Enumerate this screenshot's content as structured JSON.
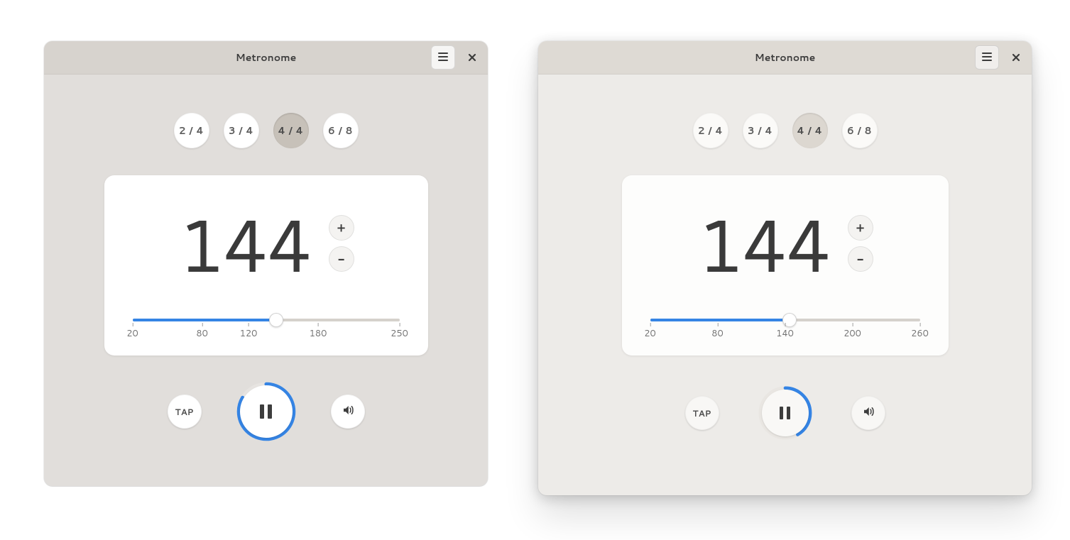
{
  "windows": [
    {
      "id": "left",
      "title": "Metronome",
      "time_signatures": [
        {
          "label": "2 / 4",
          "selected": false
        },
        {
          "label": "3 / 4",
          "selected": false
        },
        {
          "label": "4 / 4",
          "selected": true
        },
        {
          "label": "6 / 8",
          "selected": false
        }
      ],
      "bpm": "144",
      "plus": "+",
      "minus": "−",
      "slider": {
        "min": 20,
        "max": 250,
        "value": 144,
        "ticks": [
          "20",
          "80",
          "120",
          "180",
          "250"
        ],
        "tick_values": [
          20,
          80,
          120,
          180,
          250
        ]
      },
      "tap_label": "TAP",
      "progress_deg": 300
    },
    {
      "id": "right",
      "title": "Metronome",
      "time_signatures": [
        {
          "label": "2 / 4",
          "selected": false
        },
        {
          "label": "3 / 4",
          "selected": false
        },
        {
          "label": "4 / 4",
          "selected": true
        },
        {
          "label": "6 / 8",
          "selected": false
        }
      ],
      "bpm": "144",
      "plus": "+",
      "minus": "−",
      "slider": {
        "min": 20,
        "max": 260,
        "value": 144,
        "ticks": [
          "20",
          "80",
          "140",
          "200",
          "260"
        ],
        "tick_values": [
          20,
          80,
          140,
          200,
          260
        ]
      },
      "tap_label": "TAP",
      "progress_deg": 150
    }
  ]
}
